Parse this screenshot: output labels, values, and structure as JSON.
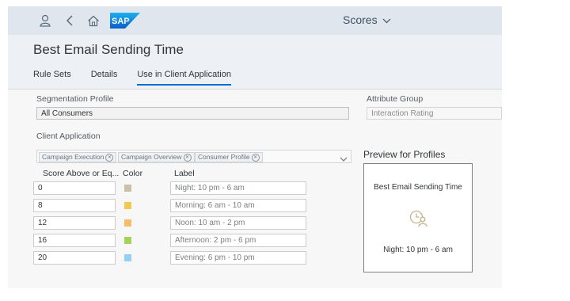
{
  "shell": {
    "app_title": "Scores",
    "logo_text": "SAP",
    "icons": [
      "user-icon",
      "back-icon",
      "home-icon",
      "chevron-down-icon"
    ]
  },
  "header": {
    "title": "Best Email Sending Time",
    "tabs": [
      {
        "label": "Rule Sets",
        "active": false
      },
      {
        "label": "Details",
        "active": false
      },
      {
        "label": "Use in Client Application",
        "active": true
      }
    ]
  },
  "form": {
    "segmentation_label": "Segmentation Profile",
    "segmentation_value": "All Consumers",
    "attribute_label": "Attribute Group",
    "attribute_value": "Interaction Rating",
    "client_app_label": "Client Application",
    "client_app_tokens": [
      "Campaign Execution",
      "Campaign Overview",
      "Consumer Profile"
    ]
  },
  "table": {
    "headers": {
      "score": "Score Above or Eq...",
      "color": "Color",
      "label": "Label"
    },
    "rows": [
      {
        "score": "0",
        "color": "#c9c1a4",
        "label": "Night: 10 pm - 6 am"
      },
      {
        "score": "8",
        "color": "#f2c94f",
        "label": "Morning: 6 am - 10 am"
      },
      {
        "score": "12",
        "color": "#f5bd6a",
        "label": "Noon: 10 am - 2 pm"
      },
      {
        "score": "16",
        "color": "#a6d15a",
        "label": "Afternoon: 2 pm - 6 pm"
      },
      {
        "score": "20",
        "color": "#94d0f5",
        "label": "Evening: 6 pm - 10 pm"
      }
    ]
  },
  "preview": {
    "title": "Preview for Profiles",
    "card_name": "Best Email Sending Time",
    "card_value": "Night: 10 pm - 6 am",
    "icon": "time-person-icon",
    "icon_color": "#c4b48a"
  },
  "colors": {
    "shell_bg": "#dfe6ee",
    "accent": "#0a6ed1",
    "sap_blue": "#1d7fd1"
  }
}
